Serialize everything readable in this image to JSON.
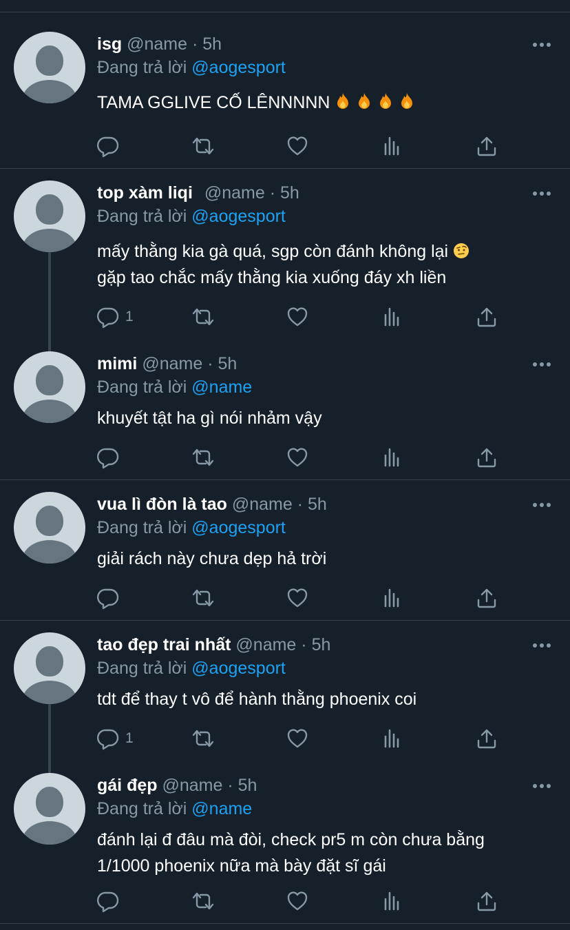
{
  "reply_prefix": "Đang trả lời",
  "tweets": [
    {
      "display_name": "isg",
      "handle": "@name",
      "time": "5h",
      "reply_to": "@aogesport",
      "text": "TAMA GGLIVE CỐ LÊNNNNN",
      "emojis": [
        "fire",
        "fire",
        "fire",
        "fire"
      ],
      "reply_count": ""
    },
    {
      "display_name": "top xàm liqi",
      "handle": "@name",
      "time": "5h",
      "reply_to": "@aogesport",
      "text_line1": "mấy thằng kia gà quá, sgp còn đánh không lại",
      "text_line2": "gặp tao chắc mấy thằng kia xuống đáy xh liền",
      "emojis": [
        "face-with-raised-eyebrow"
      ],
      "reply_count": "1"
    },
    {
      "display_name": "mimi",
      "handle": "@name",
      "time": "5h",
      "reply_to": "@name",
      "text": "khuyết tật ha gì nói nhảm vậy",
      "reply_count": ""
    },
    {
      "display_name": "vua lì đòn là tao",
      "handle": "@name",
      "time": "5h",
      "reply_to": "@aogesport",
      "text": "giải rách này chưa dẹp hả trời",
      "reply_count": ""
    },
    {
      "display_name": "tao đẹp trai nhất",
      "handle": "@name",
      "time": "5h",
      "reply_to": "@aogesport",
      "text": "tdt để thay t vô để hành thằng phoenix coi",
      "reply_count": "1"
    },
    {
      "display_name": "gái đẹp",
      "handle": "@name",
      "time": "5h",
      "reply_to": "@name",
      "text_line1": "đánh lại đ đâu mà đòi, check pr5 m còn chưa bằng",
      "text_line2": "1/1000 phoenix nữa mà bày đặt sĩ gái",
      "reply_count": ""
    }
  ],
  "icons": [
    "reply-icon",
    "retweet-icon",
    "like-icon",
    "analytics-icon",
    "share-icon",
    "more-icon",
    "avatar-placeholder"
  ],
  "colors": {
    "background": "#15202b",
    "divider": "#38444d",
    "secondary_text": "#8899a6",
    "mention": "#1da1f2",
    "avatar_bg": "#ccd6dd",
    "avatar_fg": "#66757f"
  }
}
